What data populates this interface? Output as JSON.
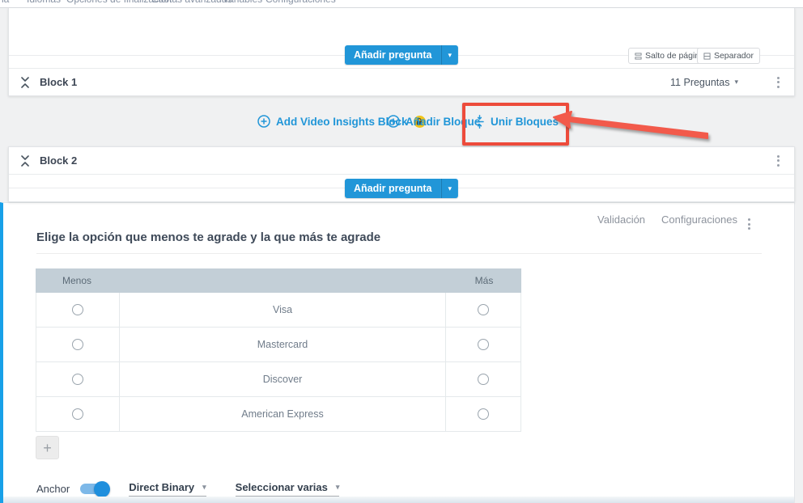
{
  "nav": {
    "items": [
      "ia",
      "Idiomas",
      "Opciones de finalización",
      "Cuotas avanzadas",
      "Variables",
      "Configuraciones"
    ]
  },
  "block1": {
    "title": "Block 1",
    "questions_count_label": "11 Preguntas",
    "add_question_label": "Añadir pregunta",
    "page_break_label": "Salto de página",
    "separator_label": "Separador"
  },
  "add_block_row": {
    "video_insights_label": "Add Video Insights Block",
    "add_block_label": "Añadir Bloque",
    "merge_blocks_label": "Unir Bloques"
  },
  "block2": {
    "title": "Block 2",
    "add_question_label": "Añadir pregunta"
  },
  "question": {
    "toolbar": {
      "validation_label": "Validación",
      "settings_label": "Configuraciones"
    },
    "title": "Elige la opción que menos te agrade y la que más te agrade",
    "table": {
      "left_header": "Menos",
      "right_header": "Más",
      "rows": [
        "Visa",
        "Mastercard",
        "Discover",
        "American Express"
      ]
    },
    "add_row_label": "+",
    "anchor_label": "Anchor",
    "model_dropdown_value": "Direct Binary",
    "select_dropdown_value": "Seleccionar varias"
  },
  "colors": {
    "accent": "#2196d8",
    "highlight": "#ed4b3b",
    "arrow": "#f25a4b",
    "stripe": "#18a0e8",
    "thead": "#c3cfd7",
    "toggle": "#1f8fdd"
  }
}
